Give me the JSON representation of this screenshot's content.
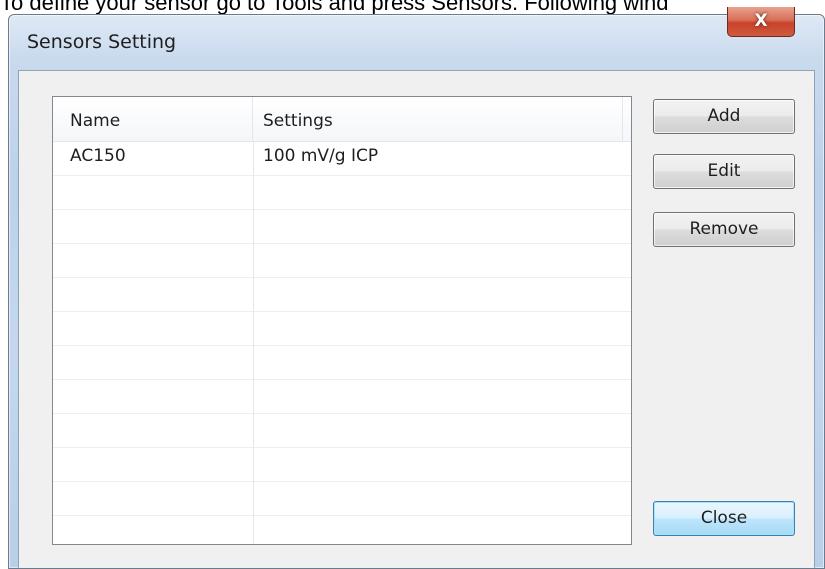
{
  "doc": {
    "instruction_text": "To define your sensor go to Tools and press Sensors. Following wind"
  },
  "window": {
    "title": "Sensors Setting",
    "close_glyph": "X"
  },
  "list": {
    "columns": [
      "Name",
      "Settings"
    ],
    "rows": [
      {
        "name": "AC150",
        "settings": "100 mV/g ICP"
      },
      {
        "name": "",
        "settings": ""
      },
      {
        "name": "",
        "settings": ""
      },
      {
        "name": "",
        "settings": ""
      },
      {
        "name": "",
        "settings": ""
      },
      {
        "name": "",
        "settings": ""
      },
      {
        "name": "",
        "settings": ""
      },
      {
        "name": "",
        "settings": ""
      },
      {
        "name": "",
        "settings": ""
      },
      {
        "name": "",
        "settings": ""
      },
      {
        "name": "",
        "settings": ""
      },
      {
        "name": "",
        "settings": ""
      }
    ]
  },
  "buttons": {
    "add": "Add",
    "edit": "Edit",
    "remove": "Remove",
    "close": "Close"
  }
}
